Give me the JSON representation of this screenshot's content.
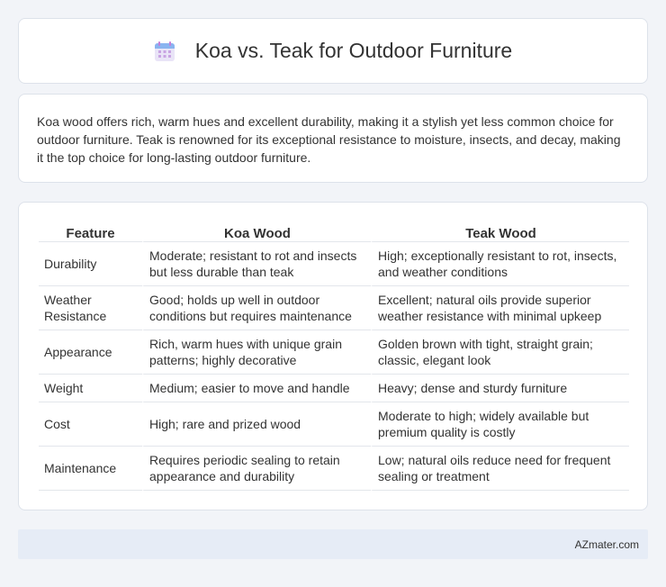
{
  "header": {
    "title": "Koa vs. Teak for Outdoor Furniture",
    "icon": "calendar-icon"
  },
  "intro": {
    "text": "Koa wood offers rich, warm hues and excellent durability, making it a stylish yet less common choice for outdoor furniture. Teak is renowned for its exceptional resistance to moisture, insects, and decay, making it the top choice for long-lasting outdoor furniture."
  },
  "table": {
    "headers": [
      "Feature",
      "Koa Wood",
      "Teak Wood"
    ],
    "rows": [
      [
        "Durability",
        "Moderate; resistant to rot and insects but less durable than teak",
        "High; exceptionally resistant to rot, insects, and weather conditions"
      ],
      [
        "Weather Resistance",
        "Good; holds up well in outdoor conditions but requires maintenance",
        "Excellent; natural oils provide superior weather resistance with minimal upkeep"
      ],
      [
        "Appearance",
        "Rich, warm hues with unique grain patterns; highly decorative",
        "Golden brown with tight, straight grain; classic, elegant look"
      ],
      [
        "Weight",
        "Medium; easier to move and handle",
        "Heavy; dense and sturdy furniture"
      ],
      [
        "Cost",
        "High; rare and prized wood",
        "Moderate to high; widely available but premium quality is costly"
      ],
      [
        "Maintenance",
        "Requires periodic sealing to retain appearance and durability",
        "Low; natural oils reduce need for frequent sealing or treatment"
      ]
    ]
  },
  "footer": {
    "text": "AZmater.com"
  }
}
